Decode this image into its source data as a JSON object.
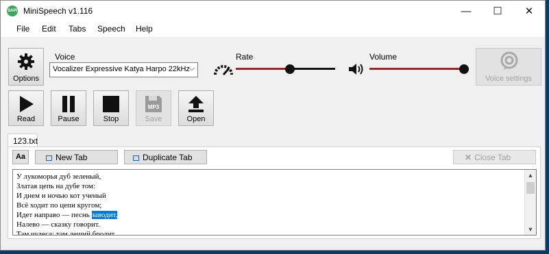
{
  "window": {
    "title": "MiniSpeech v1.116",
    "icon_text": "SAPI",
    "minimize": "—",
    "maximize": "☐",
    "close": "✕"
  },
  "menu": [
    "File",
    "Edit",
    "Tabs",
    "Speech",
    "Help"
  ],
  "toolbar": {
    "options_label": "Options",
    "voice_label": "Voice",
    "voice_value": "Vocalizer Expressive Katya Harpo 22kHz",
    "rate_label": "Rate",
    "rate_level": 0.55,
    "volume_label": "Volume",
    "volume_level": 1.0,
    "voice_settings_label": "Voice settings",
    "read_label": "Read",
    "pause_label": "Pause",
    "stop_label": "Stop",
    "save_label": "Save",
    "save_icon_text": "MP3",
    "open_label": "Open"
  },
  "tabs": [
    {
      "label": "123.txt"
    }
  ],
  "tab_toolbar": {
    "font_label": "Aa",
    "new_tab_label": "New Tab",
    "duplicate_tab_label": "Duplicate Tab",
    "close_tab_label": "Close Tab"
  },
  "editor": {
    "lines": [
      "У лукоморья дуб зеленый,",
      "Златая цепь на дубе том:",
      "И днем и ночью кот ученый",
      "Всё ходит по цепи кругом;",
      "Идет направо — песнь ",
      "Налево — сказку говорит.",
      "Там чудеса: там леший бродит,"
    ],
    "selected_text": "заводит,"
  },
  "colors": {
    "accent_red": "#d01010",
    "selection": "#0078d7"
  }
}
